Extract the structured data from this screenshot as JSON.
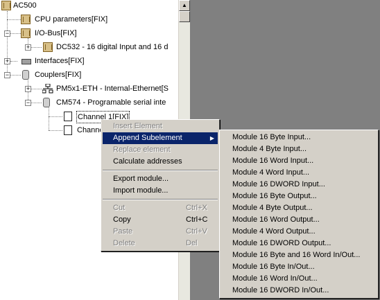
{
  "tree": {
    "root": "AC500",
    "nodes": [
      {
        "label": "CPU parameters[FIX]",
        "icon": "cpu-params-icon"
      },
      {
        "label": "I/O-Bus[FIX]",
        "icon": "io-bus-icon"
      },
      {
        "label": "DC532 - 16 digital Input and 16 d",
        "icon": "io-module-icon"
      },
      {
        "label": "Interfaces[FIX]",
        "icon": "interfaces-icon"
      },
      {
        "label": "Couplers[FIX]",
        "icon": "couplers-icon"
      },
      {
        "label": "PM5x1-ETH - Internal-Ethernet[S",
        "icon": "ethernet-icon"
      },
      {
        "label": "CM574 - Programable serial inte",
        "icon": "serial-module-icon"
      },
      {
        "label": "Channel 1[FIX]",
        "icon": "channel-icon"
      },
      {
        "label": "Channel",
        "icon": "channel-icon"
      }
    ],
    "expand_plus": "+",
    "expand_minus": "−"
  },
  "context_menu": {
    "items": [
      {
        "label": "Insert Element",
        "enabled": false
      },
      {
        "label": "Append Subelement",
        "enabled": true,
        "submenu": true,
        "highlighted": true
      },
      {
        "label": "Replace element",
        "enabled": false
      },
      {
        "label": "Calculate addresses",
        "enabled": true
      },
      {
        "label": "Export module...",
        "enabled": true
      },
      {
        "label": "Import module...",
        "enabled": true
      },
      {
        "label": "Cut",
        "shortcut": "Ctrl+X",
        "enabled": false
      },
      {
        "label": "Copy",
        "shortcut": "Ctrl+C",
        "enabled": true
      },
      {
        "label": "Paste",
        "shortcut": "Ctrl+V",
        "enabled": false
      },
      {
        "label": "Delete",
        "shortcut": "Del",
        "enabled": false
      }
    ]
  },
  "submenu": {
    "items": [
      "Module 16 Byte Input...",
      "Module 4 Byte Input...",
      "Module 16 Word Input...",
      "Module 4 Word Input...",
      "Module 16 DWORD Input...",
      "Module 16 Byte Output...",
      "Module 4 Byte Output...",
      "Module 16 Word Output...",
      "Module 4 Word Output...",
      "Module 16 DWORD Output...",
      "Module 16 Byte and 16 Word In/Out...",
      "Module 16 Byte In/Out...",
      "Module 16 Word In/Out...",
      "Module 16 DWORD In/Out..."
    ]
  },
  "colors": {
    "highlight": "#0a246a",
    "menu_bg": "#d4d0c8",
    "workspace": "#808080"
  }
}
